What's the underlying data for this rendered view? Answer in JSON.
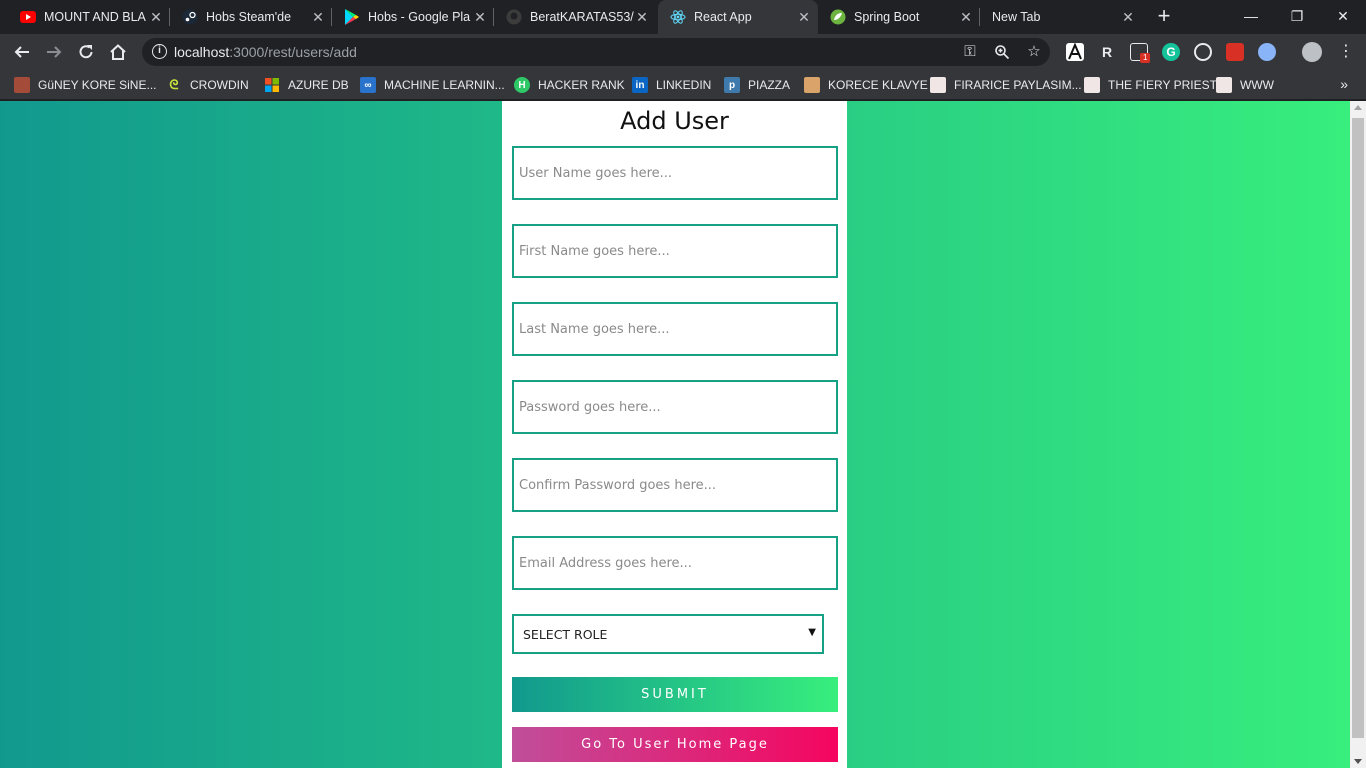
{
  "browser": {
    "tabs": [
      {
        "title": "MOUNT AND BLA",
        "icon": "youtube-icon"
      },
      {
        "title": "Hobs Steam'de",
        "icon": "steam-icon"
      },
      {
        "title": "Hobs - Google Pla",
        "icon": "google-play-icon"
      },
      {
        "title": "BeratKARATAS53/",
        "icon": "github-icon"
      },
      {
        "title": "React App",
        "icon": "react-icon"
      },
      {
        "title": "Spring Boot",
        "icon": "spring-icon"
      },
      {
        "title": "New Tab",
        "icon": ""
      }
    ],
    "url_host": "localhost",
    "url_path": ":3000/rest/users/add",
    "ext_badge": "1",
    "bookmarks": [
      {
        "label": "GüNEY KORE SiNE...",
        "icon": "film-icon"
      },
      {
        "label": "CROWDIN",
        "icon": "crowdin-icon"
      },
      {
        "label": "AZURE DB",
        "icon": "microsoft-icon"
      },
      {
        "label": "MACHINE LEARNIN...",
        "icon": "infinity-icon"
      },
      {
        "label": "HACKER RANK",
        "icon": "hackerrank-icon"
      },
      {
        "label": "LINKEDIN",
        "icon": "linkedin-icon"
      },
      {
        "label": "PIAZZA",
        "icon": "piazza-icon"
      },
      {
        "label": "KORECE KLAVYE",
        "icon": "keyboard-icon"
      },
      {
        "label": "FIRARICE PAYLASIM...",
        "icon": "manga-icon"
      },
      {
        "label": "THE FIERY PRIEST",
        "icon": "manga-icon"
      },
      {
        "label": "WWW",
        "icon": "manga-icon"
      }
    ]
  },
  "page": {
    "title": "Add User",
    "fields": {
      "username": "User Name goes here...",
      "firstname": "First Name goes here...",
      "lastname": "Last Name goes here...",
      "password": "Password goes here...",
      "confirm_password": "Confirm Password goes here...",
      "email": "Email Address goes here..."
    },
    "role_select": "SELECT ROLE",
    "submit_label": "SUBMIT",
    "home_label": "Go To User Home Page"
  },
  "colors": {
    "gradient_start": "#11998e",
    "gradient_end": "#38ef7d",
    "home_start": "#c04e9a",
    "home_end": "#f5055f",
    "field_border": "#16a085"
  }
}
